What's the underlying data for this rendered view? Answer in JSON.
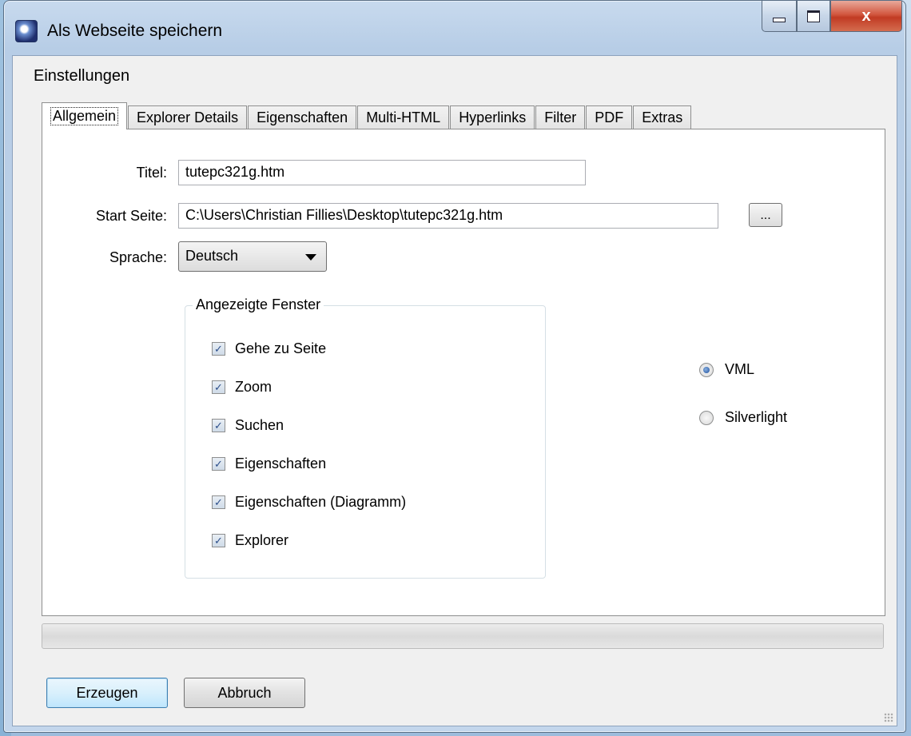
{
  "window": {
    "title": "Als Webseite speichern",
    "controls": {
      "minimize": "minimize",
      "maximize": "maximize",
      "close": "x"
    }
  },
  "section_label": "Einstellungen",
  "tabs": [
    {
      "label": "Allgemein",
      "active": true
    },
    {
      "label": "Explorer Details",
      "active": false
    },
    {
      "label": "Eigenschaften",
      "active": false
    },
    {
      "label": "Multi-HTML",
      "active": false
    },
    {
      "label": "Hyperlinks",
      "active": false
    },
    {
      "label": "Filter",
      "active": false
    },
    {
      "label": "PDF",
      "active": false
    },
    {
      "label": "Extras",
      "active": false
    }
  ],
  "form": {
    "title_label": "Titel:",
    "title_value": "tutepc321g.htm",
    "start_label": "Start Seite:",
    "start_value": "C:\\Users\\Christian Fillies\\Desktop\\tutepc321g.htm",
    "browse_label": "...",
    "language_label": "Sprache:",
    "language_value": "Deutsch"
  },
  "group": {
    "title": "Angezeigte Fenster",
    "checkboxes": [
      {
        "label": "Gehe zu Seite",
        "checked": true
      },
      {
        "label": "Zoom",
        "checked": true
      },
      {
        "label": "Suchen",
        "checked": true
      },
      {
        "label": "Eigenschaften",
        "checked": true
      },
      {
        "label": "Eigenschaften (Diagramm)",
        "checked": true
      },
      {
        "label": "Explorer",
        "checked": true
      }
    ]
  },
  "render_mode": [
    {
      "label": "VML",
      "selected": true
    },
    {
      "label": "Silverlight",
      "selected": false
    }
  ],
  "progress": {
    "fraction": 0
  },
  "buttons": {
    "create": "Erzeugen",
    "cancel": "Abbruch"
  }
}
